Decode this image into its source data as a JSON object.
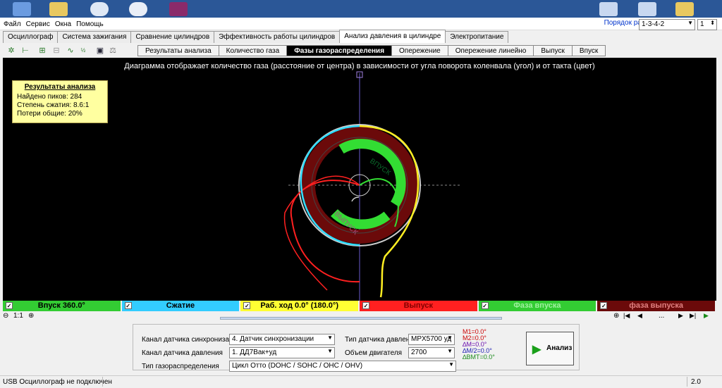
{
  "menu": [
    "Файл",
    "Сервис",
    "Окна",
    "Помощь"
  ],
  "order": {
    "label": "Порядок работы цилиндров",
    "value": "1-3-4-2",
    "cyl": "1"
  },
  "main_tabs": [
    {
      "label": "Осциллограф",
      "active": false
    },
    {
      "label": "Система зажигания",
      "active": false
    },
    {
      "label": "Сравнение цилиндров",
      "active": false
    },
    {
      "label": "Эффективность работы цилиндров",
      "active": false
    },
    {
      "label": "Анализ давления в цилиндре",
      "active": true
    },
    {
      "label": "Электропитание",
      "active": false
    }
  ],
  "sub_tabs": [
    {
      "label": "Результаты анализа",
      "active": false
    },
    {
      "label": "Количество газа",
      "active": false
    },
    {
      "label": "Фазы газораспределения",
      "active": true
    },
    {
      "label": "Опережение",
      "active": false
    },
    {
      "label": "Опережение линейно",
      "active": false
    },
    {
      "label": "Выпуск",
      "active": false
    },
    {
      "label": "Впуск",
      "active": false
    }
  ],
  "plot": {
    "caption": "Диаграмма отображает количество газа (расстояние от центра) в зависимости от угла поворота коленвала (угол) и от такта (цвет)",
    "inlet_label": "ВПУСК",
    "exhaust_label": "ВЫПУСК"
  },
  "results": {
    "title": "Результаты анализа",
    "peaks": "Найдено пиков: 284",
    "compression": "Степень сжатия: 8.6:1",
    "losses": "Потери общие: 20%"
  },
  "legend": [
    {
      "label": "Впуск 360.0°",
      "bg": "#33cc33",
      "fg": "#000000"
    },
    {
      "label": "Сжатие",
      "bg": "#33ccff",
      "fg": "#000000"
    },
    {
      "label": "Раб. ход 0.0° (180.0°)",
      "bg": "#ffff33",
      "fg": "#000000"
    },
    {
      "label": "Выпуск",
      "bg": "#ff2020",
      "fg": "#800000"
    },
    {
      "label": "Фаза впуска",
      "bg": "#33cc33",
      "fg": "#a0f0a0"
    },
    {
      "label": "фаза выпуска",
      "bg": "#6b0a0a",
      "fg": "#e08080"
    }
  ],
  "zoom": {
    "ratio": "1:1"
  },
  "nav": {
    "dots": "..."
  },
  "panel": {
    "sync_label": "Канал датчика синхронизации",
    "sync_value": "4. Датчик синхронизации",
    "pressure_label": "Канал датчика давления",
    "pressure_value": "1. ДД7Вак+уд",
    "timing_label": "Тип газораспределения",
    "timing_value": "Цикл Отто (DOHC / SOHC / OHC / OHV)",
    "sensor_type_label": "Тип датчика давления",
    "sensor_type_value": "MPX5700 уд",
    "volume_label": "Объем двигателя",
    "volume_value": "2700",
    "m1": "M1=0.0°",
    "m2": "M2=0.0°",
    "dm": "∆M=0.0°",
    "dm2": "∆M/2=0.0°",
    "dbmt": "∆ВМТ=0.0°",
    "analyze_label": "Анализ"
  },
  "status": {
    "text": "USB Осциллограф не подключен",
    "version": "2.0"
  }
}
